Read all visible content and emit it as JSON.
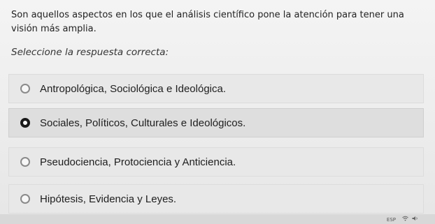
{
  "question": {
    "text": "Son aquellos aspectos en los que el análisis científico pone la atención para tener una visión más amplia."
  },
  "prompt": "Seleccione la respuesta correcta:",
  "options": [
    {
      "label": "Antropológica, Sociológica e Ideológica.",
      "selected": false
    },
    {
      "label": "Sociales, Políticos, Culturales e Ideológicos.",
      "selected": true
    },
    {
      "label": "Pseudociencia, Protociencia y Anticiencia.",
      "selected": false
    },
    {
      "label": "Hipótesis, Evidencia y Leyes.",
      "selected": false
    }
  ],
  "taskbar": {
    "language": "ESP",
    "icons": [
      "wifi-icon",
      "volume-icon"
    ]
  }
}
